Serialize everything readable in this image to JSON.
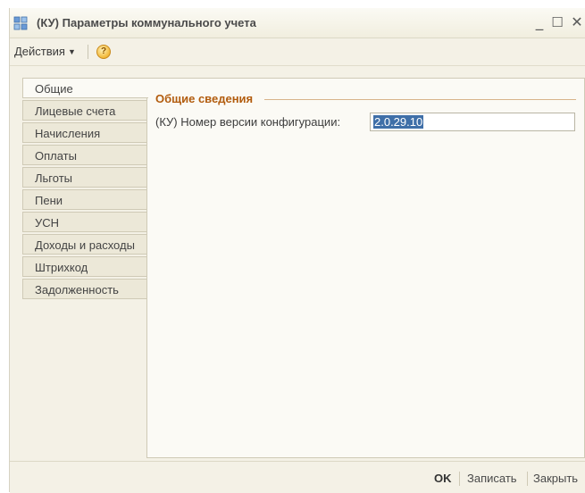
{
  "window": {
    "title": "(КУ) Параметры коммунального учета",
    "minimize": "_",
    "maximize": "☐",
    "close": "✕"
  },
  "menu": {
    "actions_label": "Действия",
    "help_label": "?"
  },
  "tabs": [
    {
      "label": "Общие",
      "active": true
    },
    {
      "label": "Лицевые счета"
    },
    {
      "label": "Начисления"
    },
    {
      "label": "Оплаты"
    },
    {
      "label": "Льготы"
    },
    {
      "label": "Пени"
    },
    {
      "label": "УСН"
    },
    {
      "label": "Доходы и расходы"
    },
    {
      "label": "Штрихкод"
    },
    {
      "label": "Задолженность"
    }
  ],
  "general": {
    "section_title": "Общие сведения",
    "version_label": "(КУ) Номер версии конфигурации:",
    "version_value": "2.0.29.10"
  },
  "footer": {
    "ok": "OK",
    "save": "Записать",
    "close": "Закрыть"
  }
}
